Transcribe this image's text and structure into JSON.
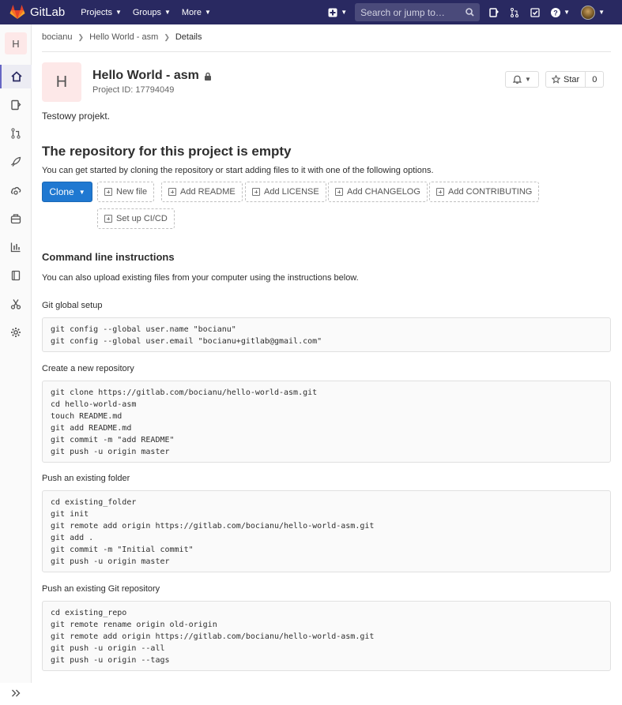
{
  "nav": {
    "brand": "GitLab",
    "menus": [
      "Projects",
      "Groups",
      "More"
    ],
    "search_placeholder": "Search or jump to…"
  },
  "breadcrumb": [
    "bocianu",
    "Hello World - asm",
    "Details"
  ],
  "project": {
    "avatar_letter": "H",
    "name": "Hello World - asm",
    "id_text": "Project ID: 17794049",
    "description": "Testowy projekt.",
    "star_label": "Star",
    "star_count": "0"
  },
  "empty": {
    "title": "The repository for this project is empty",
    "subtitle": "You can get started by cloning the repository or start adding files to it with one of the following options.",
    "clone_label": "Clone",
    "buttons": [
      "New file",
      "Add README",
      "Add LICENSE",
      "Add CHANGELOG",
      "Add CONTRIBUTING",
      "Set up CI/CD"
    ]
  },
  "cli": {
    "title": "Command line instructions",
    "subtitle": "You can also upload existing files from your computer using the instructions below.",
    "sections": [
      {
        "heading": "Git global setup",
        "lines": [
          "git config --global user.name \"bocianu\"",
          "git config --global user.email \"bocianu+gitlab@gmail.com\""
        ]
      },
      {
        "heading": "Create a new repository",
        "lines": [
          "git clone https://gitlab.com/bocianu/hello-world-asm.git",
          "cd hello-world-asm",
          "touch README.md",
          "git add README.md",
          "git commit -m \"add README\"",
          "git push -u origin master"
        ]
      },
      {
        "heading": "Push an existing folder",
        "lines": [
          "cd existing_folder",
          "git init",
          "git remote add origin https://gitlab.com/bocianu/hello-world-asm.git",
          "git add .",
          "git commit -m \"Initial commit\"",
          "git push -u origin master"
        ]
      },
      {
        "heading": "Push an existing Git repository",
        "lines": [
          "cd existing_repo",
          "git remote rename origin old-origin",
          "git remote add origin https://gitlab.com/bocianu/hello-world-asm.git",
          "git push -u origin --all",
          "git push -u origin --tags"
        ]
      }
    ]
  },
  "colors": {
    "nav_bg": "#292961",
    "primary": "#1f78d1",
    "avatar_bg": "#fde8e8"
  }
}
